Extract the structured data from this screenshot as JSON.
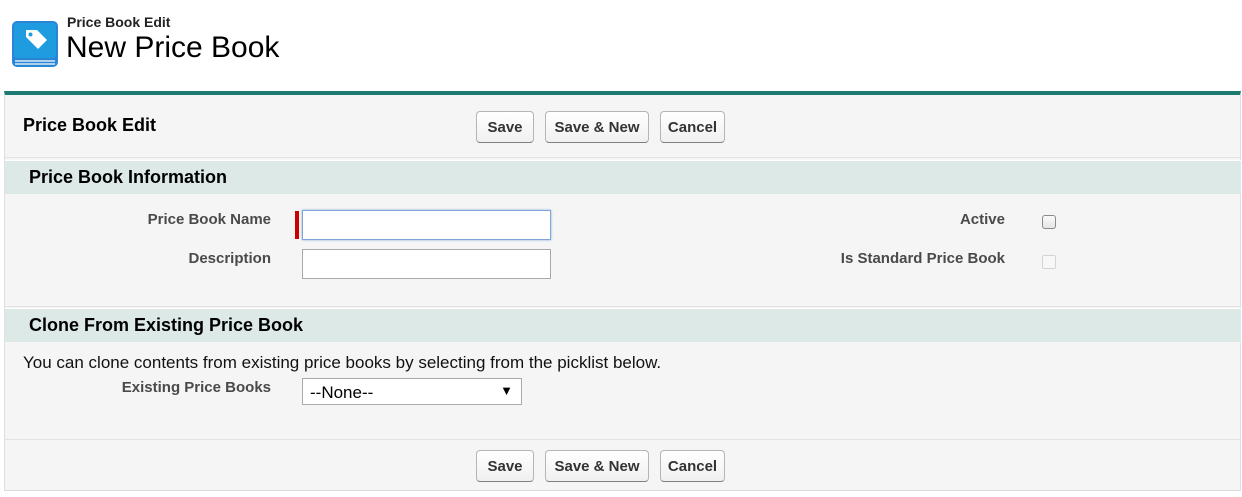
{
  "header": {
    "object_type": "Price Book Edit",
    "title": "New Price Book",
    "icon": "price-book-icon"
  },
  "edit_panel": {
    "title": "Price Book Edit",
    "buttons": {
      "save": "Save",
      "save_new": "Save & New",
      "cancel": "Cancel"
    }
  },
  "info_section": {
    "title": "Price Book Information",
    "fields": {
      "name_label": "Price Book Name",
      "name_value": "",
      "description_label": "Description",
      "description_value": "",
      "active_label": "Active",
      "active_checked": false,
      "standard_label": "Is Standard Price Book",
      "standard_checked": false
    }
  },
  "clone_section": {
    "title": "Clone From Existing Price Book",
    "help_text": "You can clone contents from existing price books by selecting from the picklist below.",
    "existing_label": "Existing Price Books",
    "existing_selected": "--None--"
  },
  "colors": {
    "accent": "#1e7b72",
    "section_bg": "#dce9e7",
    "required": "#cc0000",
    "icon_blue": "#1a8fd8"
  }
}
